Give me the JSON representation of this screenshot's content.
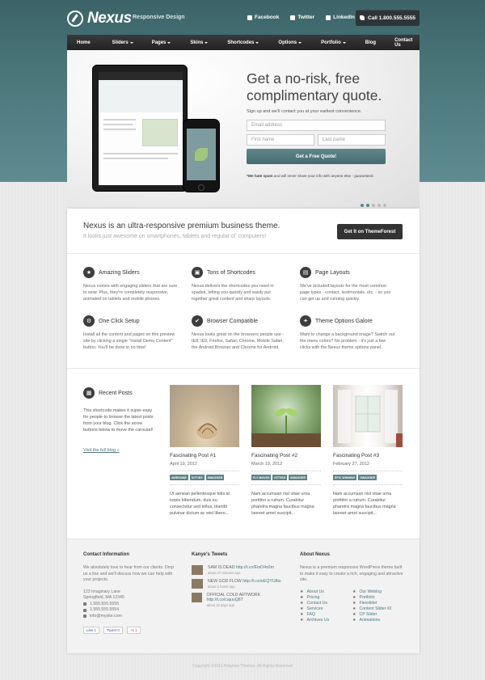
{
  "header": {
    "logo_text": "Nexus",
    "tagline": "Responsive Design",
    "social": [
      {
        "label": "Facebook",
        "icon": "facebook-icon"
      },
      {
        "label": "Twitter",
        "icon": "twitter-icon"
      },
      {
        "label": "LinkedIn",
        "icon": "linkedin-icon"
      }
    ],
    "phone": "Call 1.800.555.5555"
  },
  "nav": {
    "items": [
      {
        "label": "Home",
        "dropdown": false
      },
      {
        "label": "Sliders",
        "dropdown": true
      },
      {
        "label": "Pages",
        "dropdown": true
      },
      {
        "label": "Skins",
        "dropdown": true
      },
      {
        "label": "Shortcodes",
        "dropdown": true
      },
      {
        "label": "Options",
        "dropdown": true
      },
      {
        "label": "Portfolio",
        "dropdown": true
      },
      {
        "label": "Blog",
        "dropdown": false
      },
      {
        "label": "Contact Us",
        "dropdown": false
      }
    ]
  },
  "hero": {
    "title": "Get a no-risk, free complimentary quote.",
    "subtitle": "Sign up and we'll contact you at your earliest convenience.",
    "email_placeholder": "Email address",
    "first_name_placeholder": "First name",
    "last_name_placeholder": "Last name",
    "button": "Get a Free Quote!",
    "spam_note_bold": "*We hate spam",
    "spam_note": " and will never share your info with anyone else - guaranteed."
  },
  "intro": {
    "title": "Nexus is an ultra-responsive premium business theme.",
    "subtitle": "It looks just awesome on smartphones, tablets and regular ol' computers!",
    "button": "Get It on ThemeForest"
  },
  "features": [
    {
      "title": "Amazing Sliders",
      "icon": "star-icon",
      "glyph": "★",
      "text": "Nexus comes with engaging sliders that are sure to wow. Plus, they're completely responsive, animated on tablets and mobile phones."
    },
    {
      "title": "Tons of Shortcodes",
      "icon": "briefcase-icon",
      "glyph": "▣",
      "text": "Nexus delivers the shortcodes you need in spades, letting you quickly and easily put together great content and sharp layouts."
    },
    {
      "title": "Page Layouts",
      "icon": "document-icon",
      "glyph": "▤",
      "text": "We've included layouts for the most common page types - contact, testimonials, etc. - so you can get up and running quickly."
    },
    {
      "title": "One Click Setup",
      "icon": "setup-icon",
      "glyph": "⚙",
      "text": "Install all the content and pages on this preview site by clicking a single \"Install Demo Content\" button. You'll be done in no time!"
    },
    {
      "title": "Browser Compatible",
      "icon": "thumbs-up-icon",
      "glyph": "✔",
      "text": "Nexus looks great on the browsers people use - IE8, IE9, Firefox, Safari, Chrome, Mobile Safari, the Android Browser and Chrome for Android."
    },
    {
      "title": "Theme Options Galore",
      "icon": "gear-icon",
      "glyph": "✦",
      "text": "Want to change a background image? Switch out the menu colors? No problem - it's just a few clicks with the Nexus theme options panel."
    }
  ],
  "recent_posts": {
    "title": "Recent Posts",
    "text": "This shortcode makes it super-easy for people to browse the latest posts from your blog. Click the arrow buttons below to move the carousel!",
    "link": "Visit the full blog »",
    "posts": [
      {
        "title": "Fascinating Post #1",
        "date": "April 19, 2012",
        "tags": [
          "AWESOME",
          "KITTIES",
          "SWAGGER"
        ],
        "excerpt": "Ut aenean pellentesque felis at turpis bibendum, duis eu consectetur sed tellus, blandit pulvinar dictum ac wisi libero..."
      },
      {
        "title": "Fascinating Post #2",
        "date": "March 19, 2012",
        "tags": [
          "FLY MOVES",
          "KITTIES",
          "SWAGGER"
        ],
        "excerpt": "Nam accumsan nisl vitae urna porttitor a rutrum. Curabitur pharetra magna faucibus magna laoreet amet suscipit..."
      },
      {
        "title": "Fascinating Post #3",
        "date": "February 27, 2012",
        "tags": [
          "EPIC WINNING",
          "SWAGGER"
        ],
        "excerpt": "Nam accumsan nisl vitae urna porttitor a rutrum. Curabitur pharetra magna faucibus magna laoreet amet suscipit..."
      }
    ]
  },
  "footer": {
    "contact": {
      "title": "Contact Information",
      "text": "We absolutely love to hear from our clients. Drop us a line and we'll discuss how we can help with your projects.",
      "address1": "123 Imaginary Lane",
      "address2": "Springfield, MA 12345",
      "phone": "1.555.555.5555",
      "fax": "1.555.555.5554",
      "email": "info@mysite.com",
      "share": [
        "Like",
        "1",
        "Tweet",
        "0",
        "+1",
        "1"
      ]
    },
    "tweets": {
      "title": "Kanye's Tweets",
      "items": [
        {
          "text": "SAM IS DEAD ",
          "link": "http://t.co/EtsO4s0m",
          "time": "about 27 minutes ago"
        },
        {
          "text": "NEW GOD FLOW ",
          "link": "http://t.co/eEQYU8io",
          "time": "about 2 hours ago"
        },
        {
          "text": "OFFICIAL COLD ARTWORK ",
          "link": "http://t.co/cajuuQ8T",
          "time": "about 16 days ago"
        }
      ]
    },
    "about": {
      "title": "About Nexus",
      "text": "Nexus is a premium responsive WordPress theme built to make it easy to create a rich, engaging and attractive site.",
      "links": [
        "About Us",
        "Our Weblog",
        "Pricing",
        "Portfolio",
        "Contact Us",
        "Flexslider",
        "Services",
        "Content Slider #2",
        "FAQ",
        "CP Slider",
        "Archives Us",
        "Animations"
      ]
    }
  },
  "copyright": "Copyright ©2011 Adaptive Themes. All Rights Reserved",
  "colors": {
    "accent": "#5e8387",
    "dark": "#333333",
    "teal_bg": "#4f7c80"
  }
}
